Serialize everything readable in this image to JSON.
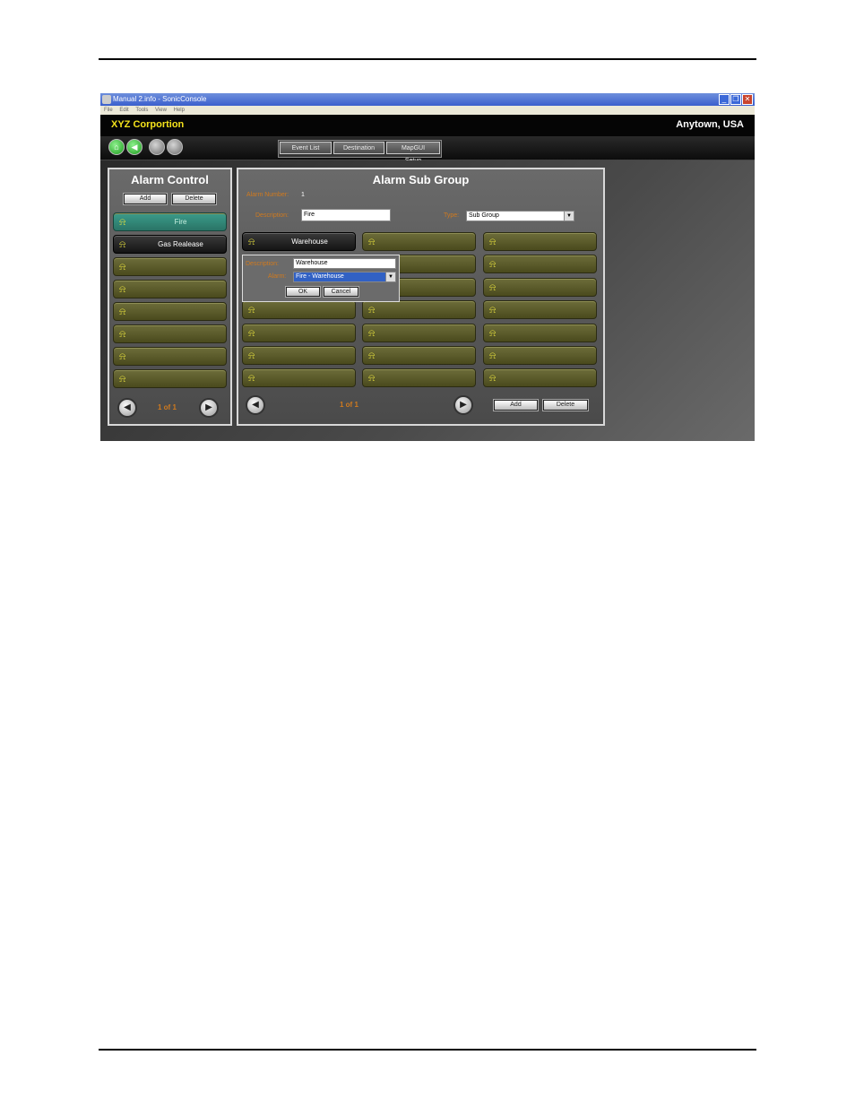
{
  "window": {
    "title": "Manual 2.info - SonicConsole",
    "menu": [
      "File",
      "Edit",
      "Tools",
      "View",
      "Help"
    ],
    "minimize": "_",
    "restore": "❐",
    "close": "✕"
  },
  "header": {
    "brand": "XYZ Corportion",
    "location": "Anytown, USA"
  },
  "toolbar": {
    "tabs": [
      "Event List",
      "Destination",
      "MapGUI Setup"
    ]
  },
  "icons": {
    "bell": "⍾",
    "home": "⌂",
    "back": "◀",
    "prev": "◀",
    "next": "▶",
    "dropdown": "▼"
  },
  "alarm_control": {
    "title": "Alarm Control",
    "add_label": "Add",
    "delete_label": "Delete",
    "items": [
      "Fire",
      "Gas Realease",
      "",
      "",
      "",
      "",
      "",
      ""
    ],
    "page_info": "1 of 1"
  },
  "alarm_sub_group": {
    "title": "Alarm Sub Group",
    "alarm_number_label": "Alarm Number:",
    "alarm_number_value": "1",
    "description_label": "Description:",
    "description_value": "Fire",
    "type_label": "Type:",
    "type_value": "Sub Group",
    "grid": [
      [
        "Warehouse",
        "",
        ""
      ],
      [
        "",
        "",
        ""
      ],
      [
        "",
        "",
        ""
      ],
      [
        "",
        "",
        ""
      ],
      [
        "",
        "",
        ""
      ],
      [
        "",
        "",
        ""
      ],
      [
        "",
        "",
        ""
      ]
    ],
    "page_info": "1 of 1",
    "add_label": "Add",
    "delete_label": "Delete"
  },
  "popup": {
    "description_label": "Description:",
    "description_value": "Warehouse",
    "alarm_label": "Alarm:",
    "alarm_value": "Fire - Warehouse",
    "ok_label": "OK",
    "cancel_label": "Cancel"
  }
}
